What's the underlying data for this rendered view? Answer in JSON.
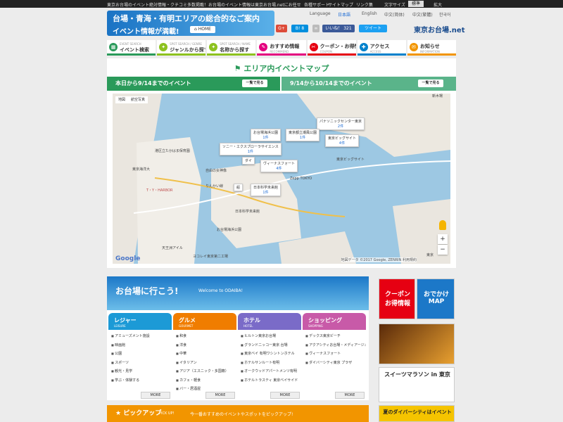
{
  "top_strip": {
    "seo_text": "東京お台場のイベント絶対情報・クチコミ多数掲載！お台場のイベント情報は東京お台場.netにお任せ",
    "links": [
      "各種サポート",
      "サイトマップ",
      "リンク集",
      "文字サイズ"
    ],
    "font_std": "標準",
    "font_big": "拡大"
  },
  "header": {
    "logo_line1": "台場・青海・有明エリアの総合的なご案内",
    "logo_line2": "イベント情報が満載!",
    "home_label": "HOME",
    "languages": [
      "Language",
      "日本語",
      "English",
      "中文(简体)",
      "中文(繁體)",
      "한국어"
    ],
    "social": {
      "gplus": "G+",
      "hatena": "B!",
      "hatena_count": "8",
      "like": "いいね！",
      "like_count": "321",
      "tweet": "ツイート"
    },
    "brand": "東京お台場.net"
  },
  "nav": [
    {
      "label": "イベント検索",
      "sub": "EVENT SEARCH",
      "color": "#2a9a5a",
      "icon": "calendar-icon",
      "glyph": "▦"
    },
    {
      "label": "ジャンルから探す",
      "sub": "SPOT SEARCH / GENRE",
      "color": "#8dc21f",
      "icon": "runner-icon",
      "glyph": "✦"
    },
    {
      "label": "名称から探す",
      "sub": "SPOT SEARCH / NAME",
      "color": "#8dc21f",
      "icon": "runner-icon",
      "glyph": "✦"
    },
    {
      "label": "おすすめ情報",
      "sub": "RECOMMEND",
      "color": "#e4007f",
      "icon": "megaphone-icon",
      "glyph": "✎"
    },
    {
      "label": "クーポン・お得情報",
      "sub": "COUPON",
      "color": "#e60012",
      "icon": "coupon-icon",
      "glyph": "✂"
    },
    {
      "label": "アクセス",
      "sub": "ACCESS",
      "color": "#0081cc",
      "icon": "person-icon",
      "glyph": "✚"
    },
    {
      "label": "お知らせ",
      "sub": "INFORMATION",
      "color": "#f29500",
      "icon": "bell-icon",
      "glyph": "✉"
    }
  ],
  "map_section": {
    "title": "エリア内イベントマップ",
    "tab1": "本日から9/14までのイベント",
    "tab2": "9/14から10/14までのイベント",
    "view_all": "一覧で見る",
    "map_types": [
      "地図",
      "航空写真"
    ],
    "bubbles": [
      {
        "name": "パナソニックセンター東京",
        "count": "2件"
      },
      {
        "name": "お台場海浜公園",
        "count": "1件"
      },
      {
        "name": "東京都立潮風公園",
        "count": "1件"
      },
      {
        "name": "東京ビッグサイト",
        "count": "4件"
      },
      {
        "name": "ソニー・エクスプローラサイエンス",
        "count": "1件"
      },
      {
        "name": "ダイ",
        "count": ""
      },
      {
        "name": "ヴィーナスフォート",
        "count": "4件"
      },
      {
        "name": "日本科学未来館",
        "count": "1件"
      },
      {
        "name": "船",
        "count": ""
      }
    ],
    "labels": [
      "東京海洋大",
      "T・Y・HARBOR",
      "りんかい線",
      "日本科学未来館",
      "お台場海浜公園",
      "東京ビッグサイト",
      "Zepp TOKYO",
      "新木場",
      "ヨコレイ東京第二工場",
      "自由の女神像",
      "港区立たかはま保育園",
      "天王洲アイル",
      "東京"
    ],
    "credit": "地図データ ©2017 Google, ZENRIN 利用規約",
    "google": "Google",
    "zoom_in": "+",
    "zoom_out": "−"
  },
  "go_section": {
    "title": "お台場に行こう!",
    "subtitle": "Welcome to ODAIBA!",
    "more": "MORE",
    "columns": [
      {
        "title": "レジャー",
        "en": "LEISURE",
        "color": "#1c9ad6",
        "items": [
          "アミューズメント施設",
          "映画館",
          "公園",
          "スポーツ",
          "観光・見学",
          "学ぶ・体験する"
        ]
      },
      {
        "title": "グルメ",
        "en": "GOURMET",
        "color": "#f07d00",
        "items": [
          "和食",
          "洋食",
          "中華",
          "イタリアン",
          "アジア（エスニック・多国籍）",
          "カフェ・軽食",
          "バー・居酒屋"
        ]
      },
      {
        "title": "ホテル",
        "en": "HOTEL",
        "color": "#7a6bc8",
        "items": [
          "ヒルトン東京お台場",
          "グランドニッコー東京 台場",
          "東京ベイ 有明ワシントンホテル",
          "ホテルサンルート有明",
          "オークウッドアパートメンツ有明",
          "ホテルトラスティ 東京ベイサイド"
        ]
      },
      {
        "title": "ショッピング",
        "en": "SHOPPING",
        "color": "#c85aa8",
        "items": [
          "デックス東京ビーチ",
          "アクアシティお台場・メディアージュ",
          "ヴィーナスフォート",
          "ダイバーシティ東京 プラザ"
        ]
      }
    ]
  },
  "pickup": {
    "title": "ピックアップ",
    "sub": "PICK UP!",
    "desc": "今一番おすすめのイベントやスポットをピックアップ!"
  },
  "sidebar": {
    "coupon": "クーポンお得情報",
    "outing": "おでかけMAP",
    "marathon": "スイーツマラソン in 東京",
    "summer": "夏のダイバーシティはイベント"
  }
}
